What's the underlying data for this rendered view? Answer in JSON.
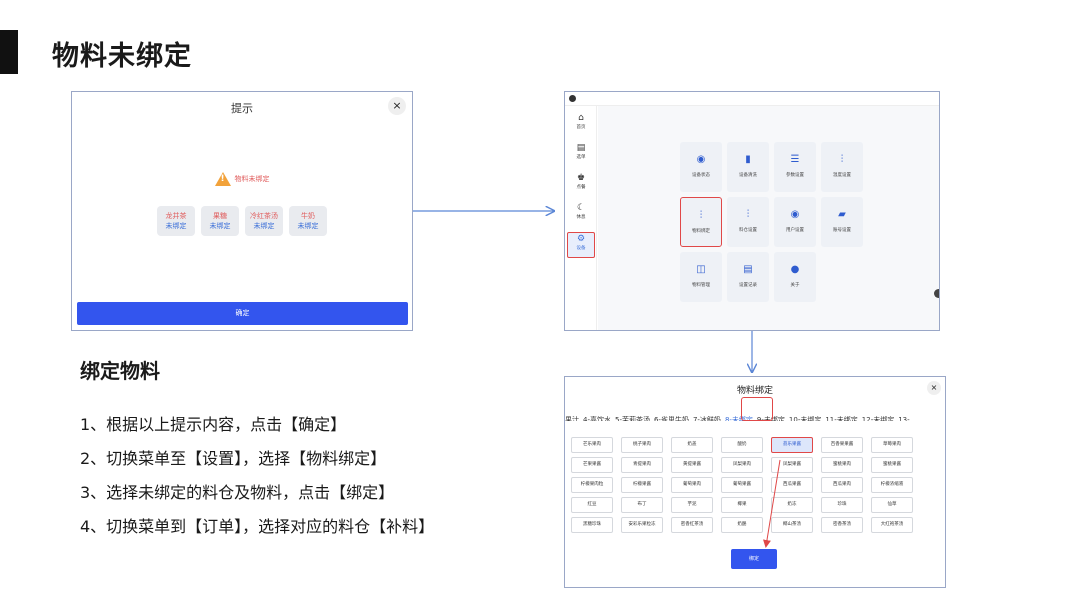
{
  "page_title": "物料未绑定",
  "dialog": {
    "title": "提示",
    "close": "×",
    "warning": "物料未绑定",
    "items": [
      {
        "name": "龙井茶",
        "status": "未绑定"
      },
      {
        "name": "果糖",
        "status": "未绑定"
      },
      {
        "name": "冷红茶汤",
        "status": "未绑定"
      },
      {
        "name": "牛奶",
        "status": "未绑定"
      }
    ],
    "confirm": "确定"
  },
  "app": {
    "sidebar": [
      {
        "icon": "⌂",
        "label": "首页"
      },
      {
        "icon": "▤",
        "label": "选单"
      },
      {
        "icon": "♚",
        "label": "点餐"
      },
      {
        "icon": "☾",
        "label": "休息"
      },
      {
        "icon": "⚙",
        "label": "设备"
      }
    ],
    "tiles": [
      {
        "icon": "◉",
        "label": "设备状态"
      },
      {
        "icon": "▮",
        "label": "设备清洗"
      },
      {
        "icon": "☰",
        "label": "参数设置"
      },
      {
        "icon": "⫶",
        "label": "温度设置"
      },
      {
        "icon": "⫶",
        "label": "物料绑定"
      },
      {
        "icon": "⫶",
        "label": "料仓设置"
      },
      {
        "icon": "◉",
        "label": "用户设置"
      },
      {
        "icon": "▰",
        "label": "账号设置"
      },
      {
        "icon": "◫",
        "label": "物料管理"
      },
      {
        "icon": "▤",
        "label": "设置记录"
      },
      {
        "icon": "●",
        "label": "关于"
      }
    ],
    "accent": "#3355ee",
    "highlight": "#e04848"
  },
  "bind": {
    "title": "物料绑定",
    "close": "×",
    "tabs": [
      "果汁",
      "4-喜饮水",
      "5-茉莉茶汤",
      "6-雀巢牛奶",
      "7-冰鲜奶",
      "8-未绑定",
      "9-未绑定",
      "10-未绑定",
      "11-未绑定",
      "12-未绑定",
      "13-"
    ],
    "active_tab": 5,
    "materials": [
      [
        "芒乐果肉",
        "桃子果肉",
        "奶盖",
        "酸奶",
        "荔乐果酱",
        "百香果果酱",
        "草莓果肉"
      ],
      [
        "芒果果酱",
        "青提果肉",
        "黄提果酱",
        "凤梨果肉",
        "凤梨果酱",
        "蜜桃果肉",
        "蜜桃果酱"
      ],
      [
        "柠檬果肉粒",
        "柠檬果酱",
        "葡萄果肉",
        "葡萄果酱",
        "西瓜果酱",
        "西瓜果肉",
        "柠檬浓缩液"
      ],
      [
        "红豆",
        "布丁",
        "芋泥",
        "椰果",
        "奶冻",
        "珍珠",
        "仙草"
      ],
      [
        "黑糖珍珠",
        "安彩乐果粒冻",
        "密香红茶汤",
        "奶酪",
        "椰山茶汤",
        "密香茶汤",
        "大红袍茶汤"
      ]
    ],
    "selected": [
      0,
      4
    ],
    "button": "绑定"
  },
  "steps": {
    "heading": "绑定物料",
    "items": [
      "1、根据以上提示内容，点击【确定】",
      "2、切换菜单至【设置】，选择【物料绑定】",
      "3、选择未绑定的料仓及物料，点击【绑定】",
      "4、切换菜单到【订单】，选择对应的料仓【补料】"
    ]
  }
}
